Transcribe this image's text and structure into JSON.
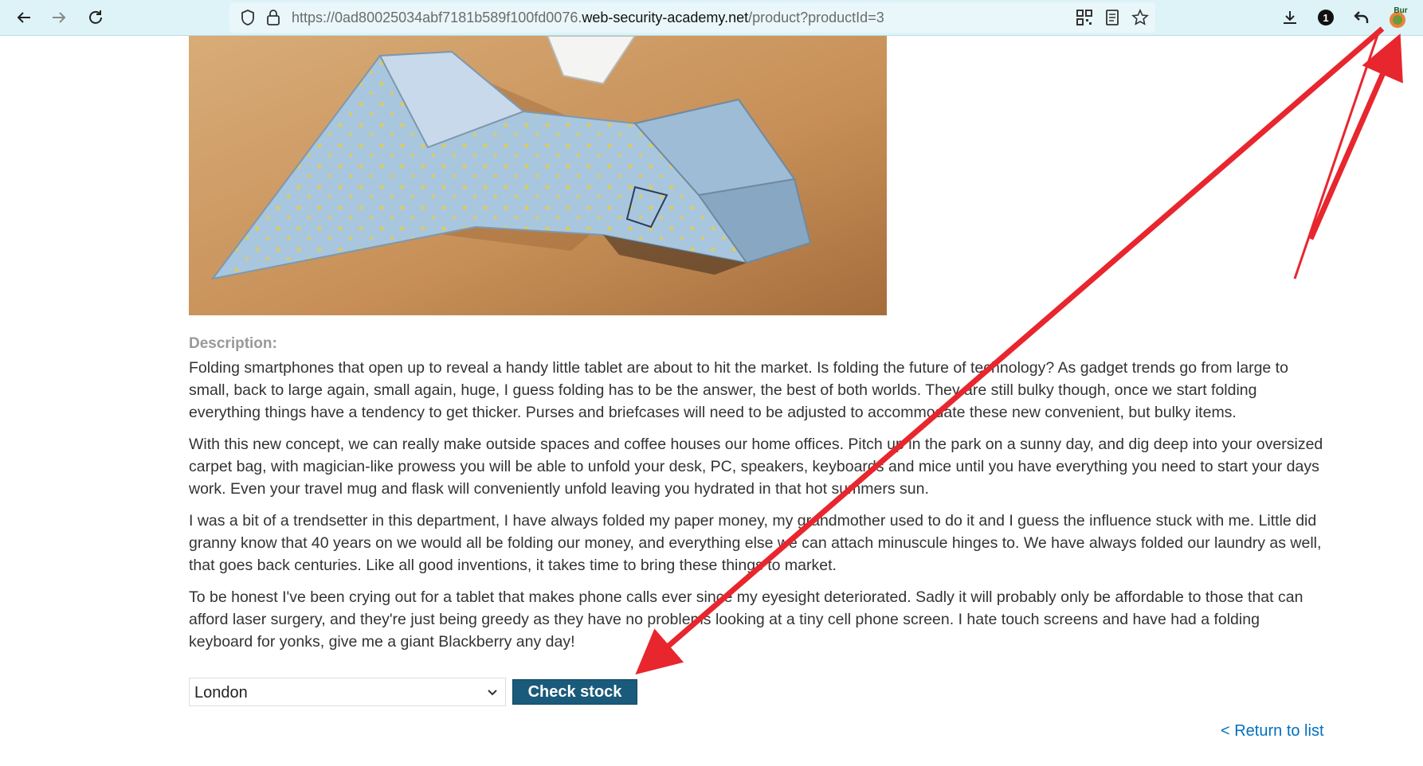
{
  "browser": {
    "url_prefix": "https://0ad80025034abf7181b589f100fd0076.",
    "url_host": "web-security-academy.net",
    "url_path": "/product?productId=3",
    "extension_label": "Bur",
    "badge_count": "1"
  },
  "product": {
    "description_label": "Description:",
    "paragraphs": [
      "Folding smartphones that open up to reveal a handy little tablet are about to hit the market. Is folding the future of technology? As gadget trends go from large to small, back to large again, small again, huge, I guess folding has to be the answer, the best of both worlds. They are still bulky though, once we start folding everything things have a tendency to get thicker. Purses and briefcases will need to be adjusted to accommodate these new convenient, but bulky items.",
      "With this new concept, we can really make outside spaces and coffee houses our home offices. Pitch up in the park on a sunny day, and dig deep into your oversized carpet bag, with magician-like prowess you will be able to unfold your desk, PC, speakers, keyboards and mice until you have everything you need to start your days work. Even your travel mug and flask will conveniently unfold leaving you hydrated in that hot summers sun.",
      "I was a bit of a trendsetter in this department, I have always folded my paper money, my grandmother used to do it and I guess the influence stuck with me. Little did granny know that 40 years on we would all be folding our money, and everything else we can attach minuscule hinges to. We have always folded our laundry as well, that goes back centuries. Like all good inventions, it takes time to bring these things to market.",
      "To be honest I've been crying out for a tablet that makes phone calls ever since my eyesight deteriorated. Sadly it will probably only be affordable to those that can afford laser surgery, and they're just being greedy as they have no problems looking at a tiny cell phone screen. I hate touch screens and have had a folding keyboard for yonks, give me a giant Blackberry any day!"
    ]
  },
  "stock": {
    "selected_store": "London",
    "check_button": "Check stock"
  },
  "return_link": "< Return to list",
  "colors": {
    "toolbar": "#ddf3f7",
    "button": "#1a5a7a",
    "link": "#0071bc",
    "annotation_arrow": "#e8262e"
  }
}
